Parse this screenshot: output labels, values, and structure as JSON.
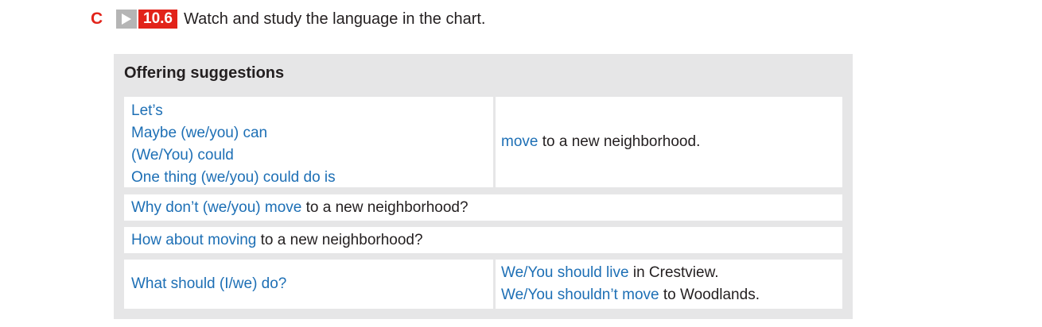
{
  "header": {
    "section_letter": "C",
    "play_icon": "play-icon",
    "track_number": "10.6",
    "instruction": "Watch and study the language in the chart."
  },
  "colors": {
    "accent_red": "#e2231a",
    "highlight_blue": "#1d6fb5",
    "chart_background": "#e6e6e7",
    "text_dark": "#231f20"
  },
  "chart": {
    "title": "Offering suggestions",
    "row1": {
      "left_lines": [
        "Let’s",
        "Maybe (we/you) can",
        "(We/You) could",
        "One thing (we/you) could do is"
      ],
      "right_highlight": "move",
      "right_rest": " to a new neighborhood."
    },
    "row2": {
      "highlight": "Why don’t (we/you) move",
      "rest": " to a new neighborhood?"
    },
    "row3": {
      "highlight": "How about moving",
      "rest": " to a new neighborhood?"
    },
    "row4": {
      "left": "What should (I/we) do?",
      "right_line1_highlight": "We/You should live",
      "right_line1_rest": " in Crestview.",
      "right_line2_highlight": "We/You shouldn’t move",
      "right_line2_rest": " to Woodlands."
    }
  }
}
